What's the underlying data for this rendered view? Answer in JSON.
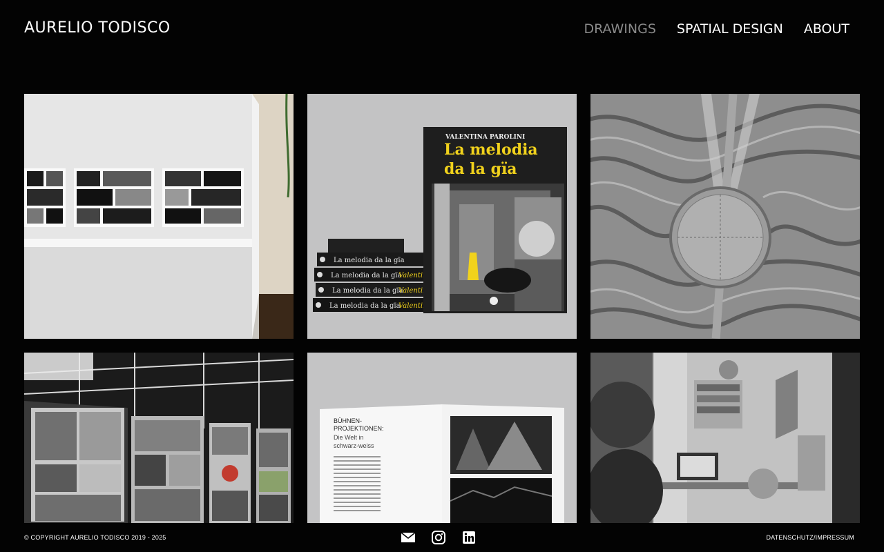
{
  "header": {
    "logo": "AURELIO TODISCO",
    "nav": [
      {
        "label": "DRAWINGS",
        "active": true
      },
      {
        "label": "SPATIAL DESIGN",
        "active": false
      },
      {
        "label": "ABOUT",
        "active": false
      }
    ]
  },
  "book": {
    "author": "VALENTINA PAROLINI",
    "title_line1": "La melodia",
    "title_line2": "da la gïa",
    "spine_title": "La melodia da la gïa",
    "spine_author": "Valentina"
  },
  "spread": {
    "heading_line1": "BÜHNEN-",
    "heading_line2": "PROJEKTIONEN:",
    "subtitle_line1": "Die Welt in",
    "subtitle_line2": "schwarz-weiss"
  },
  "footer": {
    "copyright": "© COPYRIGHT AURELIO TODISCO 2019 - 2025",
    "legal_link": "DATENSCHUTZ/IMPRESSUM",
    "icons": [
      "mail-icon",
      "instagram-icon",
      "linkedin-icon"
    ]
  },
  "colors": {
    "background": "#030303",
    "nav_active": "#8a8a8a",
    "book_title": "#f1d21c"
  }
}
